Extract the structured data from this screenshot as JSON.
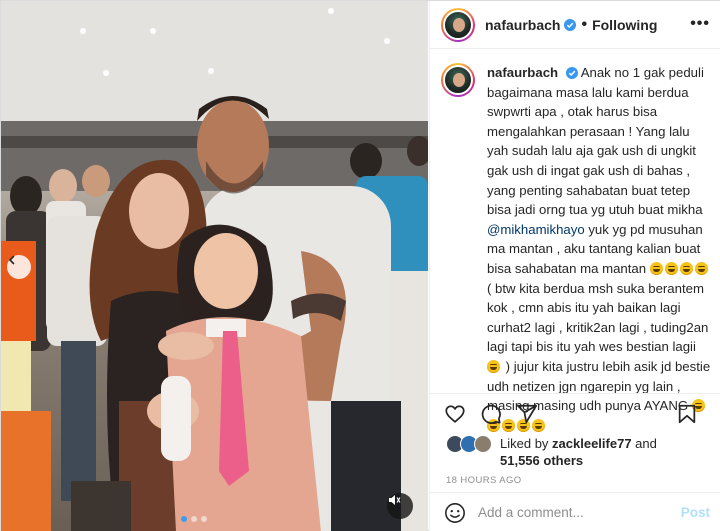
{
  "header": {
    "username": "nafaurbach",
    "separator": "•",
    "follow_label": "Following",
    "more_label": "•••"
  },
  "caption": {
    "username": "nafaurbach",
    "text_1": "Anak no 1 gak peduli bagaimana masa lalu kami berdua swpwrti apa , otak harus bisa mengalahkan perasaan ! Yang lalu yah sudah lalu aja gak ush di ungkit gak ush di ingat gak ush di bahas , yang penting sahabatan buat tetep bisa jadi orng tua yg utuh buat mikha",
    "mention": "@mikhamikhayo",
    "text_2": " yuk yg pd musuhan ma mantan , aku tantang kalian buat bisa sahabatan ma mantan ",
    "text_3": " ( btw kita berdua msh suka berantem kok , cmn abis itu yah baikan lagi curhat2 lagi , kritik2an lagi , tuding2an lagi tapi bis itu yah wes bestian lagii ",
    "text_4": " ) jujur kita justru lebih asik jd bestie udh netizen jgn ngarepin yg lain , masing masing udh punya AYANG "
  },
  "likes": {
    "prefix": "Liked by ",
    "user": "zackleelife77",
    "middle": " and",
    "count": "51,556 others"
  },
  "timestamp": "18 HOURS AGO",
  "comment": {
    "placeholder": "Add a comment...",
    "post_label": "Post"
  },
  "colors": {
    "verified": "#3897f0",
    "link": "#00376b",
    "post_disabled": "#b2dffc",
    "muted": "#8e8e8e"
  },
  "icons": [
    "verified-icon",
    "heart-icon",
    "comment-icon",
    "share-icon",
    "save-icon",
    "emoji-icon",
    "chevron-left-icon",
    "mute-icon"
  ]
}
